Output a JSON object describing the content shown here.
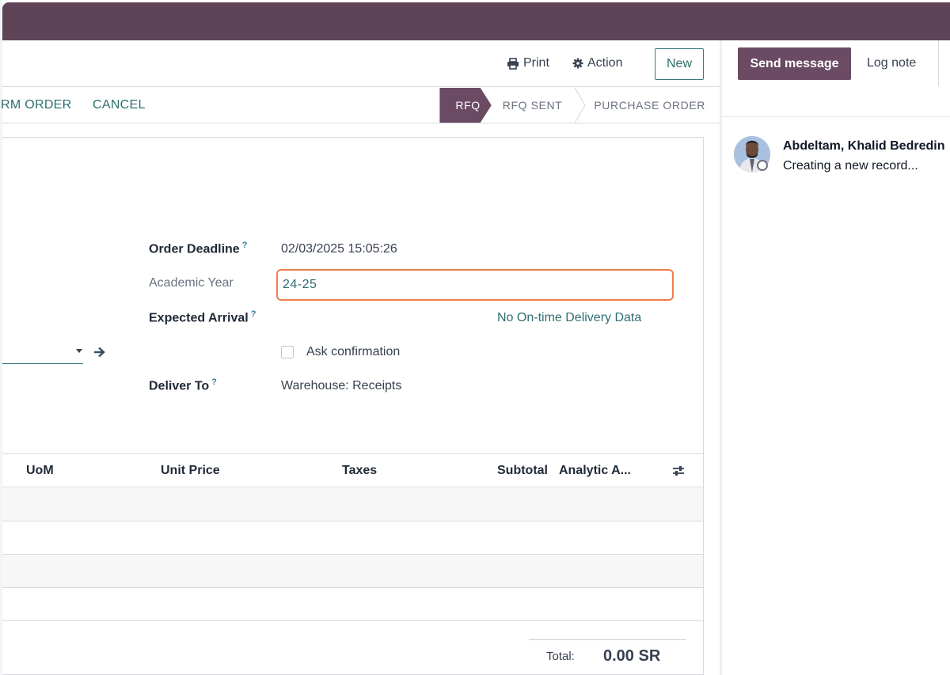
{
  "control_panel": {
    "print_label": "Print",
    "action_label": "Action",
    "new_label": "New"
  },
  "status_bar": {
    "buttons": [
      "RM ORDER",
      "CANCEL"
    ],
    "stages": [
      "RFQ",
      "RFQ SENT",
      "PURCHASE ORDER"
    ],
    "active_stage": "RFQ"
  },
  "form": {
    "order_deadline": {
      "label": "Order Deadline",
      "help": "?",
      "value": "02/03/2025 15:05:26"
    },
    "academic_year": {
      "label": "Academic Year",
      "value": "24-25"
    },
    "expected_arrival": {
      "label": "Expected Arrival",
      "help": "?",
      "info": "No On-time Delivery Data"
    },
    "ask_confirmation": {
      "label": "Ask confirmation",
      "checked": false
    },
    "deliver_to": {
      "label": "Deliver To",
      "help": "?",
      "value": "Warehouse: Receipts"
    }
  },
  "table": {
    "columns": [
      "UoM",
      "Unit Price",
      "Taxes",
      "Subtotal",
      "Analytic A..."
    ],
    "empty_rows": 4
  },
  "totals": {
    "label": "Total:",
    "value": "0.00 SR"
  },
  "chatter": {
    "send_message_label": "Send message",
    "log_note_label": "Log note",
    "messages": [
      {
        "author": "Abdeltam, Khalid Bedredin",
        "body": "Creating a new record..."
      }
    ]
  },
  "colors": {
    "brand": "#5f4458",
    "accent": "#2f6e70",
    "highlight": "#ee7f4c"
  }
}
